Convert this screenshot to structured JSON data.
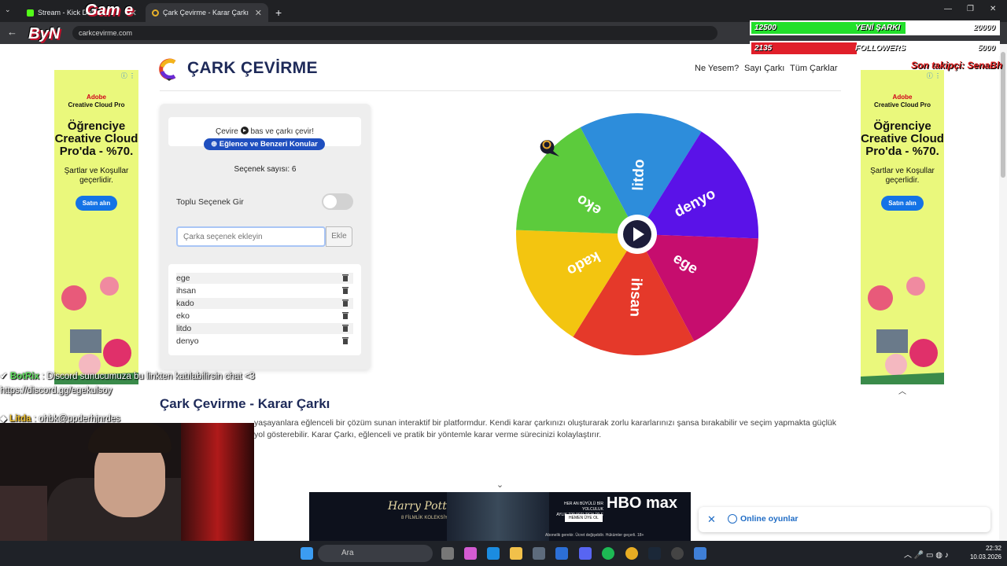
{
  "browser": {
    "tabs": [
      {
        "title": "Stream - Kick Dash"
      },
      {
        "title": "Çark Çevirme - Karar Çarkı"
      }
    ],
    "new_tab": "+",
    "url": "carkcevirme.com"
  },
  "site": {
    "title": "ÇARK ÇEVİRME",
    "nav": [
      "Ne Yesem?",
      "Sayı Çarkı",
      "Tüm Çarklar"
    ]
  },
  "panel": {
    "instruction_before": "Çevire",
    "instruction_after": "bas ve çarkı çevir!",
    "category_pill": "Eğlence ve Benzeri Konular",
    "option_count": "Seçenek sayısı: 6",
    "bulk_label": "Toplu Seçenek Gir",
    "input_placeholder": "Çarka seçenek ekleyin",
    "add_button": "Ekle",
    "options": [
      "ege",
      "ihsan",
      "kado",
      "eko",
      "litdo",
      "denyo"
    ]
  },
  "wheel": {
    "segments": [
      {
        "label": "litdo",
        "color": "#2d8ddb"
      },
      {
        "label": "denyo",
        "color": "#5a12e8"
      },
      {
        "label": "ege",
        "color": "#c60d6e"
      },
      {
        "label": "ihsan",
        "color": "#e5392a"
      },
      {
        "label": "kado",
        "color": "#f3c510"
      },
      {
        "label": "eko",
        "color": "#5ccb3c"
      }
    ]
  },
  "article": {
    "heading": "Çark Çevirme - Karar Çarkı",
    "line1_visible": "yaşayanlara eğlenceli bir çözüm sunan interaktif bir platformdur. Kendi karar çarkınızı oluşturarak zorlu kararlarınızı şansa bırakabilir ve seçim yapmakta güçlük",
    "line2_visible": "yol gösterebilir. Karar Çarkı, eğlenceli ve pratik bir yöntemle karar verme sürecinizi kolaylaştırır."
  },
  "side_ad": {
    "brand_line1": "Adobe",
    "brand_line2": "Creative Cloud Pro",
    "headline": "Öğrenciye Creative Cloud Pro'da - %70.",
    "sub": "Şartlar ve Koşullar geçerlidir.",
    "button": "Satın alın"
  },
  "bottom_ad": {
    "title": "Harry Potter",
    "subtitle": "8 FİLMLİK KOLEKSİYON",
    "promo": "HER AN BÜYÜLÜ BİR YOLCULUK",
    "price": "AYLIK 229,90TL'DEN İZLE",
    "cta": "HEMEN ÜYE OL",
    "brand": "HBO max",
    "legal": "Abonelik gerekir. Ücret değişebilir. Hükümler geçerli. 18+"
  },
  "online_games": "Online oyunlar",
  "stream": {
    "goal1": {
      "current": "12500",
      "label": "YENİ ŞARKI",
      "target": "20000",
      "progress": 0.625
    },
    "goal2": {
      "current": "2135",
      "label": "FOLLOWERS",
      "target": "5000",
      "progress": 0.427
    },
    "last_follower": "Son takipçi: SenaBh",
    "chat": [
      {
        "user": "BotRix",
        "text": ": Discord sunucumuza bu linkten katılabilirsin chat <3 https://discord.gg/egekulsoy"
      },
      {
        "user": "Litda",
        "text": ": ohbk@ppderhjnrdes"
      }
    ]
  },
  "taskbar": {
    "search": "Ara",
    "time": "22:32",
    "date": "10.03.2026"
  }
}
